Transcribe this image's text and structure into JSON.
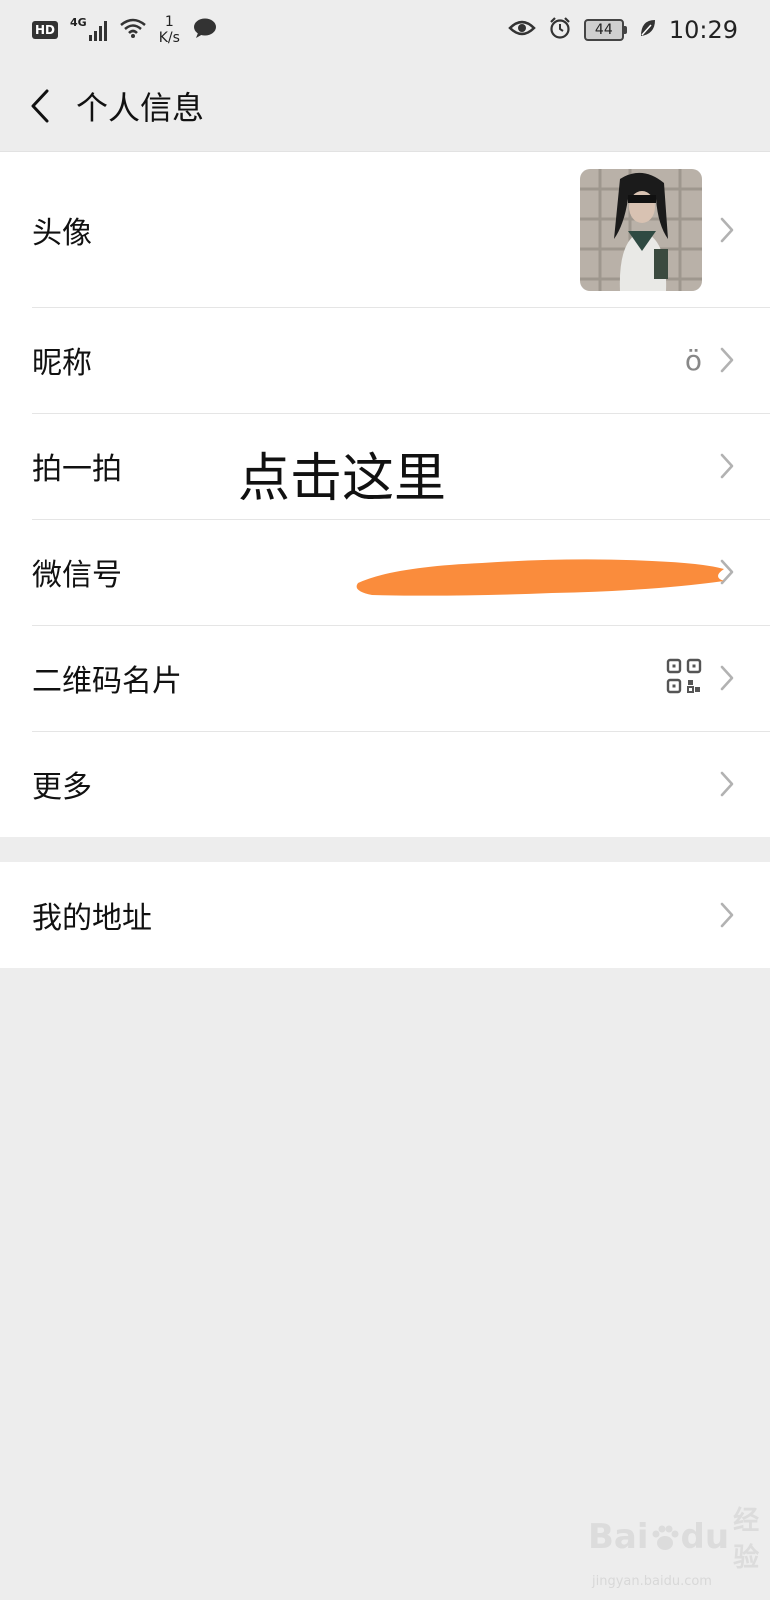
{
  "status_bar": {
    "hd": "HD",
    "network": "4G",
    "speed_value": "1",
    "speed_unit": "K/s",
    "battery": "44",
    "time": "10:29"
  },
  "header": {
    "title": "个人信息"
  },
  "rows": {
    "avatar": {
      "label": "头像"
    },
    "nickname": {
      "label": "昵称",
      "value": "ö"
    },
    "pat": {
      "label": "拍一拍"
    },
    "wechat_id": {
      "label": "微信号"
    },
    "qr_card": {
      "label": "二维码名片"
    },
    "more": {
      "label": "更多"
    },
    "address": {
      "label": "我的地址"
    }
  },
  "annotation": {
    "text": "点击这里",
    "redaction_color": "#fa8c3c"
  },
  "watermark": {
    "brand_left": "Bai",
    "brand_right": "du",
    "brand_cn": "经验",
    "sub": "jingyan.baidu.com"
  },
  "colors": {
    "background": "#ededed",
    "card": "#ffffff",
    "chevron": "#b2b2b2"
  },
  "icons": {
    "back": "chevron-left-icon",
    "row_arrow": "chevron-right-icon",
    "qr": "qr-code-icon"
  }
}
